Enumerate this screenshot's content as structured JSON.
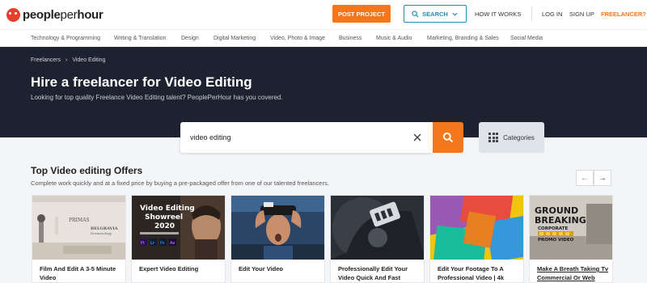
{
  "header": {
    "logo": {
      "bold": "people",
      "light": "per",
      "bold2": "hour"
    },
    "post_project": "POST PROJECT",
    "search": "SEARCH",
    "how_it_works": "HOW IT WORKS",
    "login": "LOG IN",
    "signup": "SIGN UP",
    "freelancer": "FREELANCER?"
  },
  "categories": [
    "Technology & Programming",
    "Writing & Translation",
    "Design",
    "Digital Marketing",
    "Video, Photo & Image",
    "Business",
    "Music & Audio",
    "Marketing, Branding & Sales",
    "Social Media"
  ],
  "hero": {
    "breadcrumb": [
      "Freelancers",
      "Video Editing"
    ],
    "breadcrumb_sep": "›",
    "title": "Hire a freelancer for Video Editing",
    "subtitle": "Looking for top quality Freelance Video Editing talent? PeoplePerHour has you covered."
  },
  "search": {
    "value": "video editing",
    "categories_label": "Categories"
  },
  "offers": {
    "title": "Top Video editing Offers",
    "subtitle": "Complete work quickly and at a fixed price by buying a pre-packaged offer from one of our talented freelancers.",
    "prev": "←",
    "next": "→",
    "cards": [
      {
        "title": "Film And Edit A 3-5 Minute Video",
        "img_text": [
          "PRIMAS",
          "BELGRAVIA",
          "Dermatology"
        ]
      },
      {
        "title": "Expert Video Editing",
        "img_text": [
          "Video Editing",
          "Showreel",
          "2020",
          "Pr",
          "Lr",
          "Ps",
          "Ae"
        ]
      },
      {
        "title": "Edit Your Video",
        "img_text": []
      },
      {
        "title": "Professionally Edit Your Video Quick And Fast",
        "img_text": []
      },
      {
        "title": "Edit Your Footage To A Professional Video | 4k",
        "img_text": []
      },
      {
        "title": "Make A Breath Taking Tv Commercial Or Web",
        "img_text": [
          "GROUND",
          "BREAKING",
          "CORPORATE",
          "PROMO VIDEO"
        ]
      }
    ]
  },
  "colors": {
    "accent": "#f4771b",
    "search_blue": "#1f8fb6",
    "hero_bg": "#1c2230"
  }
}
